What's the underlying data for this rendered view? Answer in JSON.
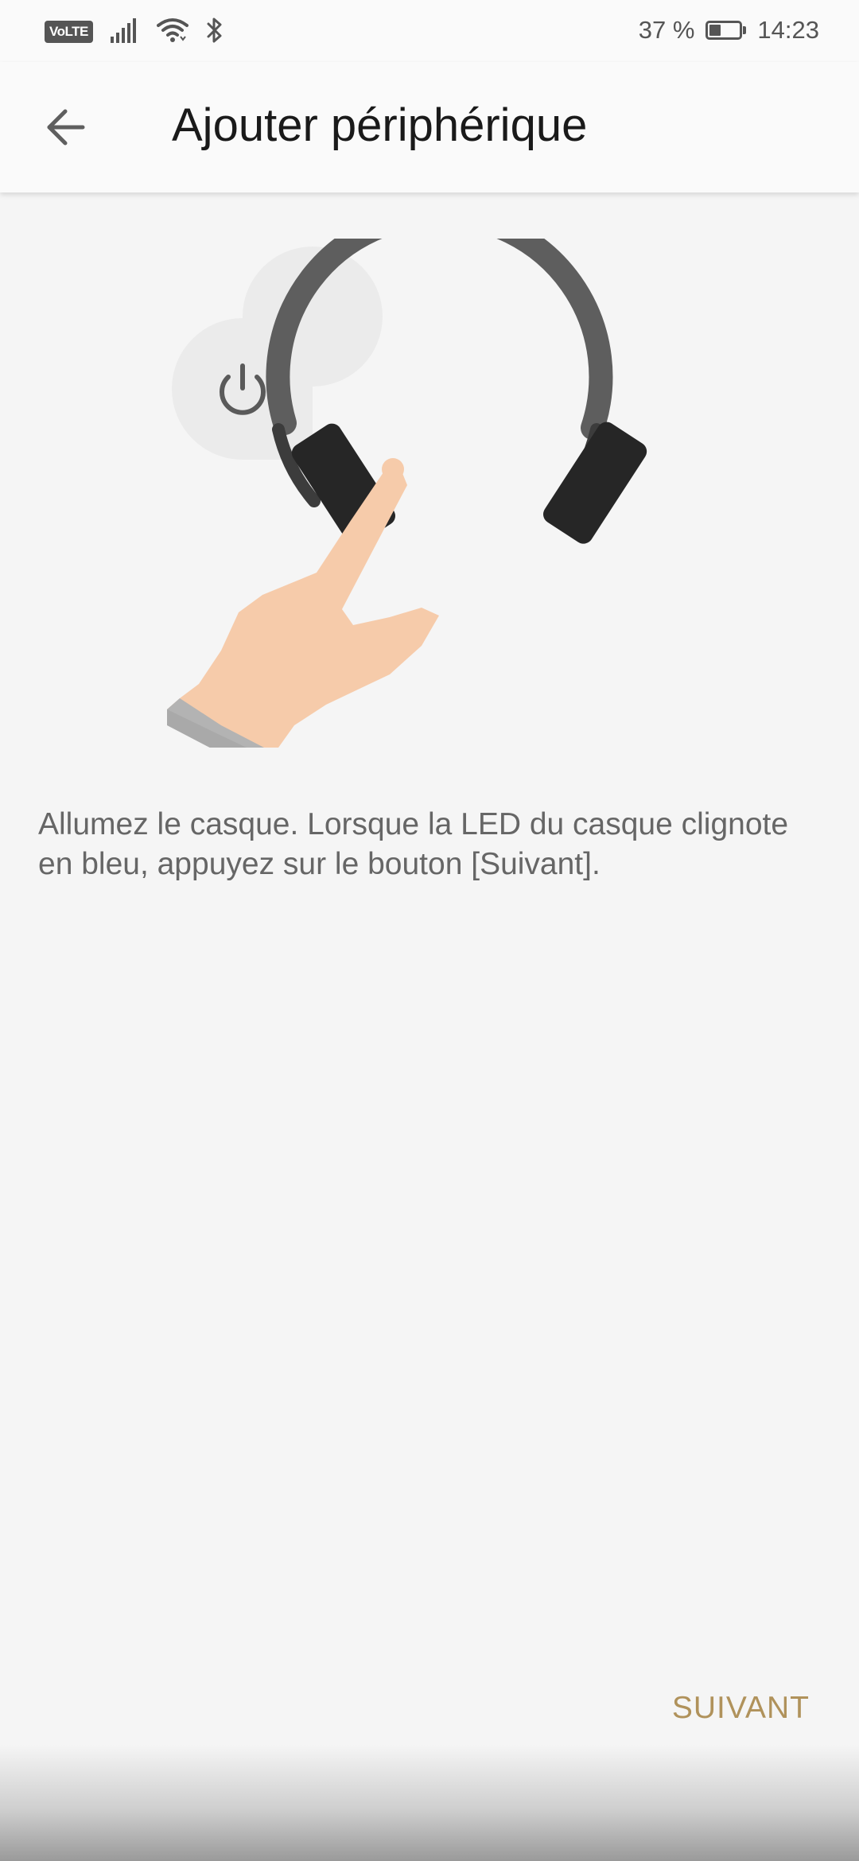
{
  "status_bar": {
    "network_badge": "VoLTE",
    "battery_text": "37 %",
    "battery_level": 0.37,
    "time": "14:23",
    "icons": [
      "signal-icon",
      "wifi-icon",
      "bluetooth-icon",
      "battery-icon"
    ]
  },
  "app_bar": {
    "back_icon": "arrow-left-icon",
    "title": "Ajouter périphérique"
  },
  "illustration": {
    "subject": "headphones",
    "action": "finger pressing power button",
    "power_icon": "power-icon"
  },
  "content": {
    "instruction": "Allumez le casque. Lorsque la LED du casque clignote en bleu, appuyez sur le bouton [Suivant]."
  },
  "actions": {
    "next_label": "SUIVANT"
  },
  "colors": {
    "accent": "#b0925b",
    "background": "#f5f5f5",
    "appbar": "#fafafa"
  }
}
